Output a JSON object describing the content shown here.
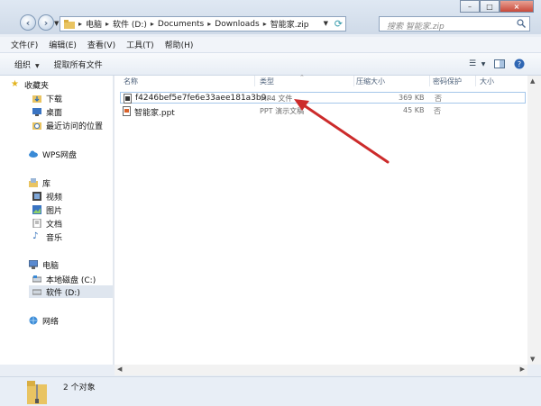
{
  "address": {
    "crumbs": [
      "电脑",
      "软件 (D:)",
      "Documents",
      "Downloads",
      "智能家.zip"
    ],
    "search_placeholder": "搜索 智能家.zip"
  },
  "menu": [
    "文件(F)",
    "编辑(E)",
    "查看(V)",
    "工具(T)",
    "帮助(H)"
  ],
  "toolbar": {
    "organize": "组织",
    "extract_all": "提取所有文件"
  },
  "columns": [
    "名称",
    "类型",
    "压缩大小",
    "密码保护",
    "大小"
  ],
  "files": [
    {
      "name": "f4246bef5e7fe6e33aee181a3b9...",
      "type": "MP4 文件",
      "size": "369 KB",
      "password": "否"
    },
    {
      "name": "智能家.ppt",
      "type": "PPT 演示文稿",
      "size": "45 KB",
      "password": "否"
    }
  ],
  "nav": {
    "favorites": "收藏夹",
    "downloads": "下载",
    "desktop": "桌面",
    "recent": "最近访问的位置",
    "wps": "WPS网盘",
    "library": "库",
    "videos": "视频",
    "pictures": "图片",
    "documents": "文档",
    "music": "音乐",
    "computer": "电脑",
    "local_c": "本地磁盘 (C:)",
    "software_d": "软件 (D:)",
    "network": "网络"
  },
  "status": {
    "count": "2 个对象"
  },
  "colors": {
    "accent": "#cc2b2b",
    "selection_border": "#a5c7ea"
  }
}
